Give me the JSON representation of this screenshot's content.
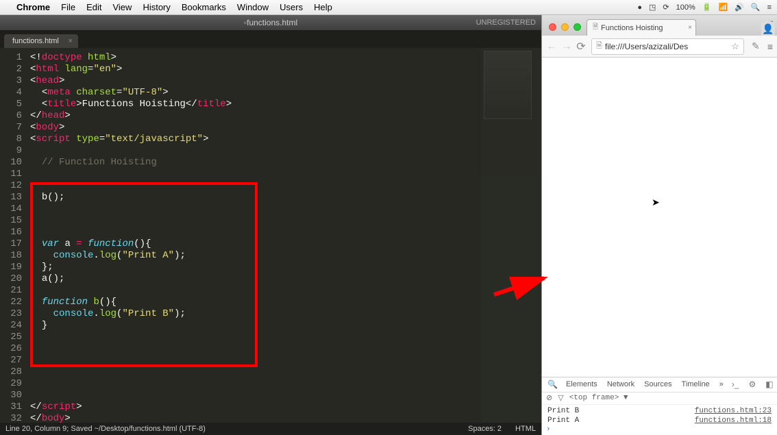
{
  "mac_menu": {
    "app": "Chrome",
    "items": [
      "File",
      "Edit",
      "View",
      "History",
      "Bookmarks",
      "Window",
      "Users",
      "Help"
    ],
    "battery": "100%"
  },
  "editor": {
    "title": "functions.html",
    "unregistered": "UNREGISTERED",
    "tab": "functions.html",
    "status_left": "Line 20, Column 9; Saved ~/Desktop/functions.html (UTF-8)",
    "status_spaces": "Spaces: 2",
    "status_lang": "HTML",
    "code_lines": [
      "<!doctype html>",
      "<html lang=\"en\">",
      "<head>",
      "  <meta charset=\"UTF-8\">",
      "  <title>Functions Hoisting</title>",
      "</head>",
      "<body>",
      "<script type=\"text/javascript\">",
      "",
      "  // Function Hoisting",
      "",
      "",
      "  b();",
      "",
      "",
      "",
      "  var a = function(){",
      "    console.log(\"Print A\");",
      "  };",
      "  a();",
      "",
      "  function b(){",
      "    console.log(\"Print B\");",
      "  }",
      "",
      "",
      "",
      "",
      "",
      "",
      "</script>",
      "</body>"
    ]
  },
  "chrome": {
    "tab_title": "Functions Hoisting",
    "url": "file:///Users/azizali/Des",
    "devtools": {
      "tabs": [
        "Elements",
        "Network",
        "Sources",
        "Timeline"
      ],
      "more": "»",
      "frame": "<top frame> ▼",
      "console": [
        {
          "msg": "Print B",
          "src": "functions.html:23"
        },
        {
          "msg": "Print A",
          "src": "functions.html:18"
        }
      ]
    }
  }
}
